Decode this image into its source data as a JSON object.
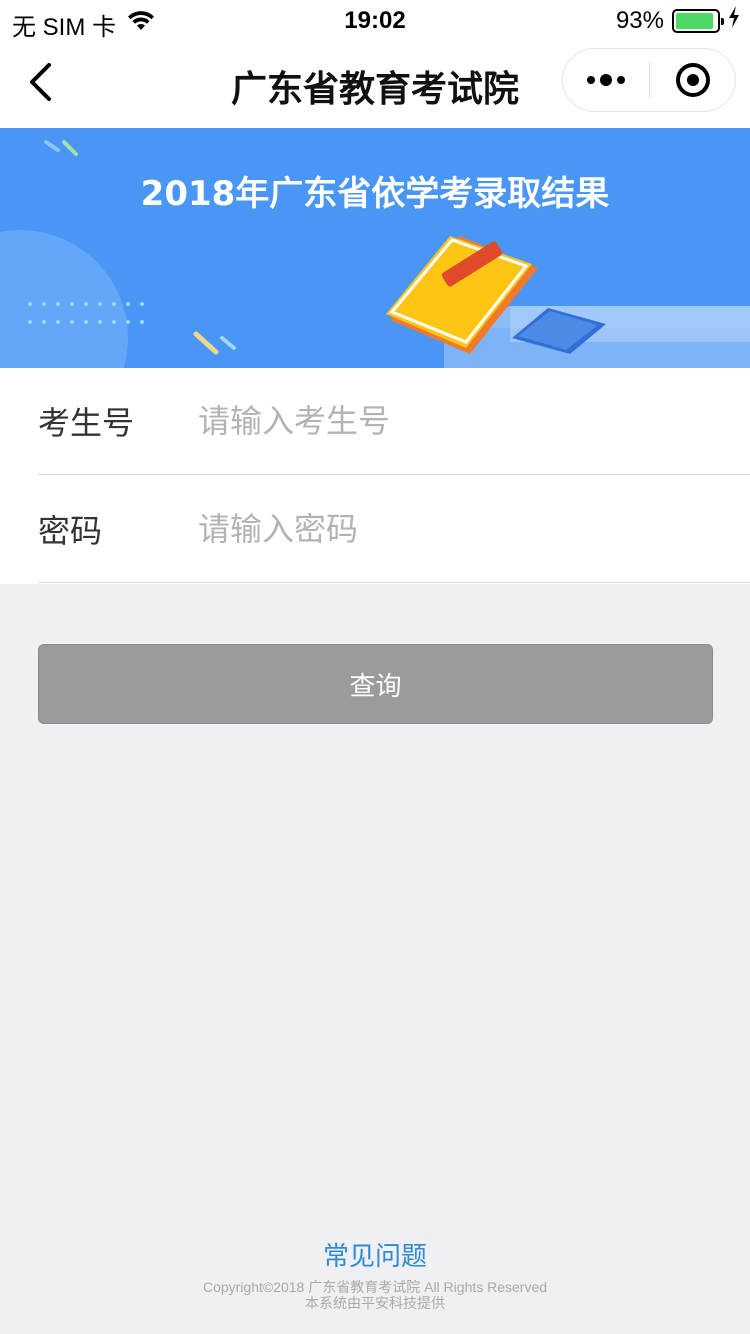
{
  "status_bar": {
    "carrier": "无 SIM 卡",
    "time": "19:02",
    "battery_percent": "93%",
    "battery_level": 0.93
  },
  "nav": {
    "title": "广东省教育考试院",
    "back_icon": "chevron-left-icon",
    "more_icon": "more-dots-icon",
    "close_icon": "target-circle-icon"
  },
  "banner": {
    "title": "2018年广东省依学考录取结果",
    "background_color": "#4a96f5"
  },
  "form": {
    "exam_number": {
      "label": "考生号",
      "placeholder": "请输入考生号",
      "value": ""
    },
    "password": {
      "label": "密码",
      "placeholder": "请输入密码",
      "value": ""
    }
  },
  "actions": {
    "query_label": "查询"
  },
  "footer": {
    "faq_label": "常见问题",
    "copyright_line1": "Copyright©2018 广东省教育考试院 All Rights Reserved",
    "copyright_line2": "本系统由平安科技提供"
  },
  "colors": {
    "accent": "#2e8bd8",
    "button_disabled": "#9b9b9b",
    "page_background": "#efeff4"
  }
}
